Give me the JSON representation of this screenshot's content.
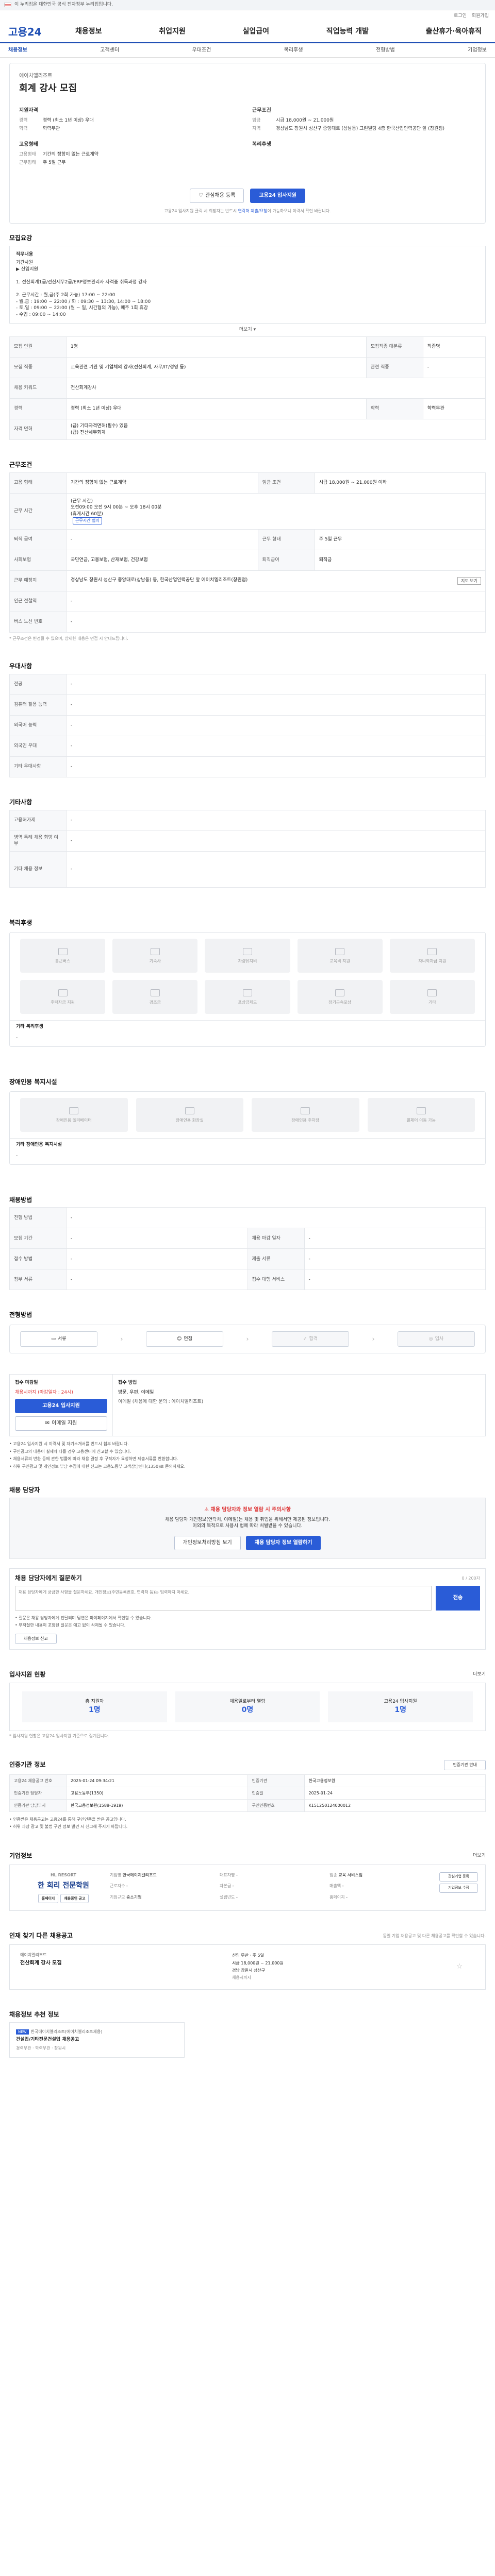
{
  "topbar": {
    "text": "이 누리집은 대한민국 공식 전자정부 누리집입니다."
  },
  "utility": {
    "login": "로그인",
    "join": "회원가입"
  },
  "gnb": {
    "logo": "고용24",
    "menu": [
      "채용정보",
      "취업지원",
      "실업급여",
      "직업능력 개발",
      "출산휴가·육아휴직"
    ]
  },
  "subtabs": [
    {
      "label": "채용정보"
    },
    {
      "label": "고객센터"
    },
    {
      "label": "우대조건"
    },
    {
      "label": "복리후생"
    },
    {
      "label": "전형방법"
    },
    {
      "label": "기업정보"
    }
  ],
  "job": {
    "company": "에이치엘리조트",
    "title": "회계 강사 모집",
    "req_title": "지원자격",
    "req": [
      {
        "k": "경력",
        "v": "경력 (최소 1년 이상) 우대"
      },
      {
        "k": "학력",
        "v": "학력무관"
      }
    ],
    "cond_title": "근무조건",
    "cond": [
      {
        "k": "임금",
        "v": "시급 18,000원 ~ 21,000원"
      },
      {
        "k": "지역",
        "v": "경상남도 창원시 성산구 중앙대로 (상남동) 그린빌딩 4층 한국산업인력공단 앞 (창원점)"
      }
    ],
    "emp_title": "고용형태",
    "emp": [
      {
        "k": "고용형태",
        "v": "기간의 정함이 없는 근로계약"
      },
      {
        "k": "근무형태",
        "v": "주 5일 근무"
      }
    ],
    "welfare_title": "복리후생",
    "btn_interest": "관심채용 등록",
    "btn_apply": "고용24 입사지원",
    "apply_note_a": "고용24 입사지원 클릭 시 희망자는 반드시",
    "apply_note_b": "연락처 제출/요청",
    "apply_note_c": "이 가능하오니 이력서 확인 바랍니다."
  },
  "recruit": {
    "title": "모집요강",
    "duty_label": "직무내용",
    "duty": "기간사원\n▶ 신입지원\n\n1. 전산회계1급/전산세무2급/ERP정보관리사 자격증 취득과정 강사\n\n2. 근무시간 : 월,금(주 2회 가능) 17:00 ~ 22:00\n  - 월,금 : 19:00 ~ 22:00 / 화 : 09:30 ~ 13:30, 14:00 ~ 18:00\n  - 토,일 : 09:00 ~ 22:00 (월 ~ 일, 시간협의 가능), 매주 1회 휴강\n  - 수업 : 09:00 ~ 14:00",
    "more": "더보기",
    "rows": [
      [
        "모집 인원",
        "1명",
        "모집직종 대분류",
        "직종명"
      ],
      [
        "모집 직종",
        "교육관련 기관 및 기업체의 강사(전산회계, 사무/IT/경영 등)",
        "관련 직종",
        "-"
      ],
      [
        "채용 키워드",
        "전산회계강사",
        "",
        ""
      ],
      [
        "경력",
        "경력 (최소 1년 이상) 우대",
        "학력",
        "학력무관"
      ],
      [
        "자격 면허",
        "(급) 기타자격면허(필수) 있음\n(급) 전산세무회계",
        "",
        ""
      ]
    ]
  },
  "work": {
    "title": "근무조건",
    "rows": [
      [
        "고용 형태",
        "기간의 정함이 없는 근로계약",
        "임금 조건",
        "시급 18,000원 ~ 21,000원 이하"
      ],
      [
        "근무 시간",
        "(근무 시간)\n오전09:00 오전 9시 00분 ~ 오후 18시 00분\n(휴게시간 60분)",
        "",
        ""
      ],
      [
        "퇴직 급여",
        "-",
        "근무 형태",
        "주 5일 근무"
      ],
      [
        "사회보험",
        "국민연금, 고용보험, 산재보험, 건강보험",
        "퇴직급여",
        "퇴직금"
      ],
      [
        "근무 예정지",
        "경상남도 창원시 성산구 중앙대로(상남동) 등, 한국산업인력공단 앞 에이치엘리조트(창원점)",
        "",
        ""
      ],
      [
        "인근 전철역",
        "-",
        "",
        ""
      ],
      [
        "버스 노선 번호",
        "-",
        "",
        ""
      ]
    ],
    "map_btn": "지도 보기",
    "chip": "근무시간 협의",
    "note": "* 근무조건은 변경될 수 있으며, 상세한 내용은 면접 시 안내드립니다."
  },
  "pref": {
    "title": "우대사항",
    "rows": [
      [
        "전공",
        "-"
      ],
      [
        "컴퓨터 활용 능력",
        "-"
      ],
      [
        "외국어 능력",
        "-"
      ],
      [
        "외국인 우대",
        "-"
      ],
      [
        "기타 우대사항",
        "-"
      ]
    ]
  },
  "hire": {
    "title": "기타사항",
    "rows": [
      [
        "고용허가제",
        "-"
      ],
      [
        "병역 특례 채용 희망 여부",
        "-"
      ],
      [
        "기타 채용 정보",
        "-"
      ]
    ]
  },
  "welfare": {
    "title": "복리후생",
    "items": [
      "통근버스",
      "기숙사",
      "차량유지비",
      "교육비 지원",
      "자녀학자금 지원",
      "주택자금 지원",
      "경조금",
      "포상금제도",
      "장기근속포상",
      "기타"
    ],
    "sub_title": "기타 복리후생",
    "sub_body": "-"
  },
  "disabled": {
    "title": "장애인용 복지시설",
    "items": [
      "장애인용 엘리베이터",
      "장애인용 화장실",
      "장애인용 주차장",
      "휠체어 이동 가능"
    ],
    "sub_title": "기타 장애인용 복지시설",
    "sub_body": "-"
  },
  "method": {
    "title": "채용방법",
    "rows": [
      [
        "전형 방법",
        "-",
        "",
        ""
      ],
      [
        "모집 기간",
        "-",
        "채용 마감 일자",
        "-"
      ],
      [
        "접수 방법",
        "-",
        "제출 서류",
        "-"
      ],
      [
        "첨부 서류",
        "-",
        "접수 대행 서비스",
        "-"
      ]
    ]
  },
  "process": {
    "title": "전형방법",
    "steps": [
      "서류",
      "면접",
      "합격",
      "입사"
    ]
  },
  "apply": {
    "left_title": "접수 마감일",
    "deadline": "채용시까지 (마감일자 : 24시)",
    "btn_apply": "고용24 입사지원",
    "btn_email": "이메일 지원",
    "right_title": "접수 방법",
    "method": "방문, 우편, 이메일",
    "contact": "이메일 (채용에 대한 문의 : 에이치엘리조트)",
    "bullets": [
      "고용24 입사지원 시 이력서 및 자기소개서를 반드시 첨부 바랍니다.",
      "구인공고의 내용이 실제와 다를 경우 고용센터에 신고할 수 있습니다.",
      "채용서류의 반환 등에 관한 법률에 따라 채용 결정 후 구직자가 요청하면 제출서류를 반환합니다.",
      "허위 구인광고 및 개인정보 부당 수집에 대한 신고는 고용노동부 고객상담센터(1350)로 문의하세요."
    ]
  },
  "manager": {
    "title": "채용 담당자",
    "alert_title": "채용 담당자와 정보 열람 시 주의사항",
    "alert_body": "채용 담당자 개인정보(연락처, 이메일)는 채용 및 취업을 위해서만 제공된 정보입니다.\n이외의 목적으로 사용시 법에 따라 처벌받을 수 있습니다.",
    "btn_view": "개인정보처리방침 보기",
    "btn_mgr": "채용 담당자 정보 열람하기",
    "qa_title": "채용 담당자에게 질문하기",
    "qa_placeholder": "채용 담당자에게 궁금한 사항을 질문하세요. 개인정보(주민등록번호, 연락처 등)는 입력하지 마세요.",
    "qa_btn": "전송",
    "qa_count": "0 / 200자",
    "qa_notes": [
      "질문은 채용 담당자에게 전달되며 답변은 마이페이지에서 확인할 수 있습니다.",
      "부적절한 내용이 포함된 질문은 예고 없이 삭제될 수 있습니다."
    ],
    "report_btn": "채용정보 신고"
  },
  "status": {
    "title": "입사지원 현황",
    "more": "더보기",
    "items": [
      {
        "label": "총 지원자",
        "value": "1명"
      },
      {
        "label": "채용일로부터 열람",
        "value": "0명"
      },
      {
        "label": "고용24 입사지원",
        "value": "1명"
      }
    ],
    "note": "* 입사지원 현황은 고용24 입사지원 기준으로 집계됩니다."
  },
  "info": {
    "title": "인증기관 정보",
    "btn": "인증기관 안내",
    "rows": [
      [
        "고용24 채용공고 번호",
        "2025-01-24 09:34:21",
        "인증기관",
        "한국고용정보원"
      ],
      [
        "인증기관 담당자",
        "고용노동부(1350)",
        "인증일",
        "2025-01-24"
      ],
      [
        "인증기관 담당부서",
        "한국고용정보원(1588-1919)",
        "구인인증번호",
        "K151250124000012"
      ]
    ],
    "notes": [
      "인증받은 채용공고는 고용24를 통해 구인인증을 받은 공고입니다.",
      "허위 과장 광고 및 불법 구인 정보 발견 시 신고해 주시기 바랍니다."
    ]
  },
  "company": {
    "title": "기업정보",
    "more": "더보기",
    "logo_top": "HL RESORT",
    "logo_main": "한 회리 전문학원",
    "cols": [
      [
        "기업명",
        "한국에이치엘리조트"
      ],
      [
        "대표자명",
        "-"
      ],
      [
        "업종",
        "교육 서비스업"
      ],
      [
        "근로자수",
        "-"
      ],
      [
        "자본금",
        "-"
      ],
      [
        "매출액",
        "-"
      ],
      [
        "기업규모",
        "중소기업"
      ],
      [
        "설립년도",
        "-"
      ],
      [
        "홈페이지",
        "-"
      ]
    ],
    "btn_home": "홈페이지",
    "btn_list": "채용중인 공고",
    "btn_a": "관심기업 등록",
    "btn_b": "기업정보 수정"
  },
  "other": {
    "title": "인재 찾기 다른 채용공고",
    "more": "더보기",
    "hint": "동일 기업 채용공고 및 다른 채용공고를 확인할 수 있습니다.",
    "company": "에이치엘리조트",
    "job": "전산회계 강사 모집",
    "m1": "신입 무관",
    "m2": "주 5일",
    "m3": "시급 18,000원 ~ 21,000원",
    "m4": "경남 창원시 성산구",
    "close": "채용시까지"
  },
  "new": {
    "title": "채용정보 추천 정보",
    "tag": "NEW",
    "company": "한국에이치엘리조트(에이치엘리조트채용)",
    "job": "건설업/기타전문건설업 채용공고",
    "meta": "경력무관 · 학력무관 · 창원시"
  }
}
